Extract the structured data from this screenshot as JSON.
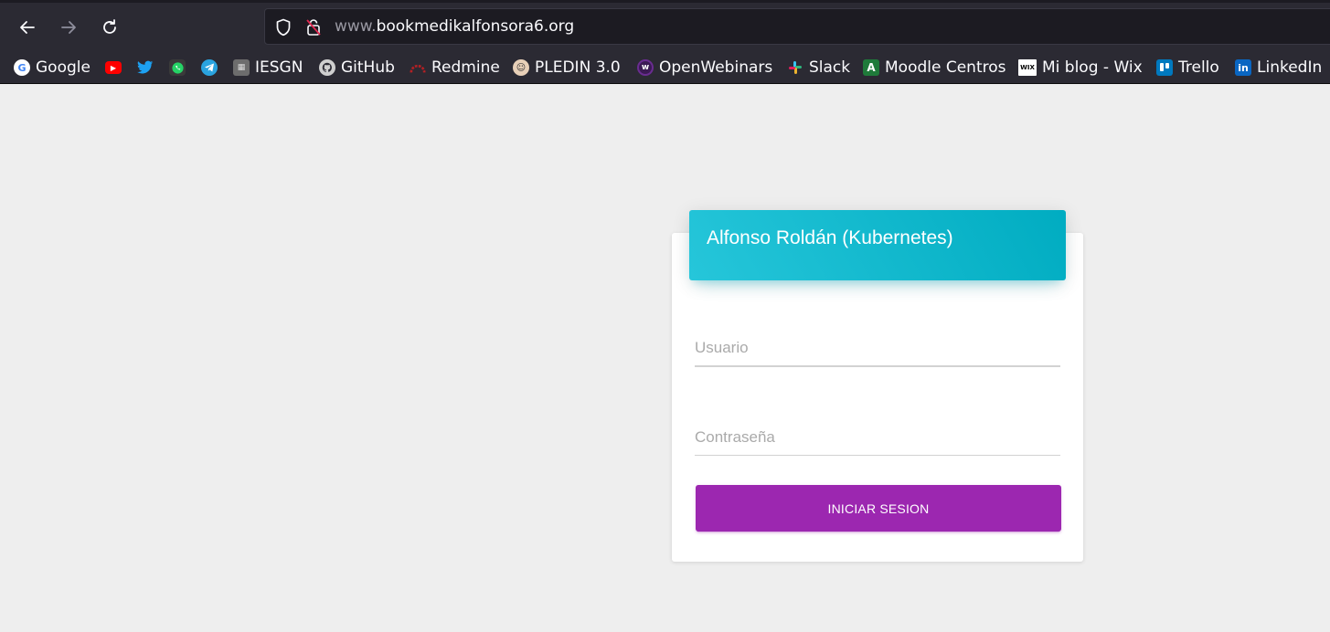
{
  "browser": {
    "url_prefix": "www.",
    "url_domain": "bookmedikalfonsora6.org",
    "back_icon": "back-arrow-icon",
    "forward_icon": "forward-arrow-icon",
    "reload_icon": "reload-icon"
  },
  "bookmarks": [
    {
      "label": "Google",
      "icon": "google-icon",
      "color": "#ffffff"
    },
    {
      "label": "",
      "icon": "youtube-icon",
      "color": "#ff0000"
    },
    {
      "label": "",
      "icon": "twitter-icon",
      "color": "#1da1f2"
    },
    {
      "label": "",
      "icon": "whatsapp-icon",
      "color": "#25d366"
    },
    {
      "label": "",
      "icon": "telegram-icon",
      "color": "#2aa3df"
    },
    {
      "label": "IESGN",
      "icon": "iesgn-icon",
      "color": "#6d6d6d"
    },
    {
      "label": "GitHub",
      "icon": "github-icon",
      "color": "#cfcfcf"
    },
    {
      "label": "Redmine",
      "icon": "redmine-icon",
      "color": "#b32024"
    },
    {
      "label": "PLEDIN 3.0",
      "icon": "pledin-icon",
      "color": "#e8d0b8"
    },
    {
      "label": "OpenWebinars",
      "icon": "openwebinars-icon",
      "color": "#6a2c91"
    },
    {
      "label": "Slack",
      "icon": "slack-icon",
      "color": "#e01e5a"
    },
    {
      "label": "Moodle Centros",
      "icon": "moodle-icon",
      "color": "#1f7a3a"
    },
    {
      "label": "Mi blog - Wix",
      "icon": "wix-icon",
      "color": "#ffffff"
    },
    {
      "label": "Trello",
      "icon": "trello-icon",
      "color": "#0079bf"
    },
    {
      "label": "LinkedIn",
      "icon": "linkedin-icon",
      "color": "#0a66c2"
    }
  ],
  "login": {
    "title": "Alfonso Roldán (Kubernetes)",
    "username_placeholder": "Usuario",
    "password_placeholder": "Contraseña",
    "submit_label": "INICIAR SESION",
    "header_color": "#00acc1",
    "button_color": "#9c27b0"
  }
}
